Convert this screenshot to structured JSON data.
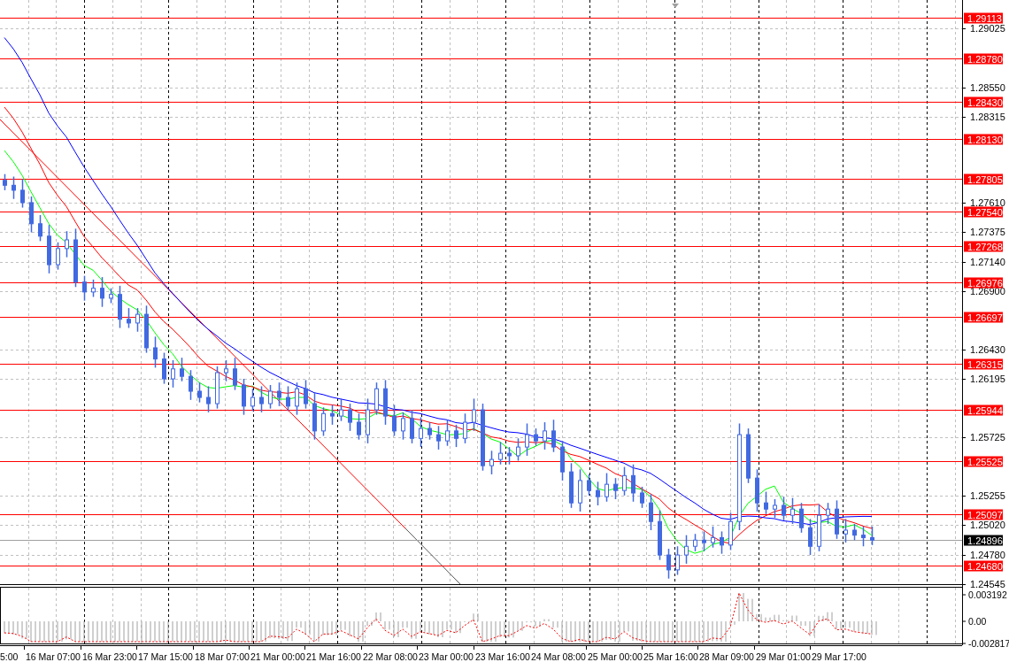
{
  "price_axis": {
    "labels": [
      "1.29025",
      "1.28550",
      "1.28315",
      "1.27610",
      "1.27375",
      "1.27140",
      "1.26900",
      "1.26430",
      "1.26195",
      "1.25725",
      "1.25255",
      "1.25020",
      "1.24780",
      "1.24545"
    ]
  },
  "levels": [
    {
      "label": "1.29113"
    },
    {
      "label": "1.28780"
    },
    {
      "label": "1.28430"
    },
    {
      "label": "1.28130"
    },
    {
      "label": "1.27805"
    },
    {
      "label": "1.27540"
    },
    {
      "label": "1.27268"
    },
    {
      "label": "1.26976"
    },
    {
      "label": "1.26697"
    },
    {
      "label": "1.26315"
    },
    {
      "label": "1.25944"
    },
    {
      "label": "1.25525"
    },
    {
      "label": "1.25097"
    },
    {
      "label": "1.24680"
    }
  ],
  "current_price": {
    "label": "1.24896"
  },
  "moving_averages": [
    {
      "color": "#00ff00"
    },
    {
      "color": "#ff0000"
    },
    {
      "color": "#0000ff"
    }
  ],
  "time_axis": {
    "labels": [
      "5:00",
      "16 Mar 07:00",
      "16 Mar 23:00",
      "17 Mar 15:00",
      "18 Mar 07:00",
      "21 Mar 00:00",
      "21 Mar 16:00",
      "22 Mar 08:00",
      "23 Mar 00:00",
      "23 Mar 16:00",
      "24 Mar 08:00",
      "25 Mar 00:00",
      "25 Mar 16:00",
      "28 Mar 09:00",
      "29 Mar 01:00",
      "29 Mar 17:00"
    ]
  },
  "oscillator": {
    "labels": [
      "0.003192",
      "0.00",
      "-0.002817"
    ]
  }
}
